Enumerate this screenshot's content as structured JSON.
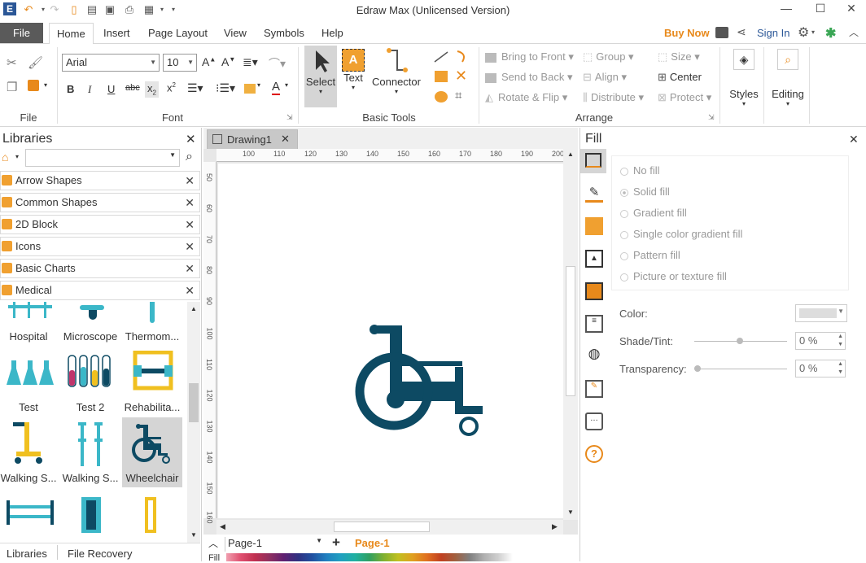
{
  "window": {
    "title": "Edraw Max (Unlicensed Version)"
  },
  "menu": {
    "file": "File",
    "tabs": [
      "Home",
      "Insert",
      "Page Layout",
      "View",
      "Symbols",
      "Help"
    ],
    "buy_now": "Buy Now",
    "sign_in": "Sign In"
  },
  "ribbon": {
    "file_group": "File",
    "font_group": "Font",
    "font_name": "Arial",
    "font_size": "10",
    "basic_tools_group": "Basic Tools",
    "select": "Select",
    "text": "Text",
    "connector": "Connector",
    "arrange_group": "Arrange",
    "bring_to_front": "Bring to Front",
    "send_to_back": "Send to Back",
    "rotate_flip": "Rotate & Flip",
    "group": "Group",
    "align": "Align",
    "distribute": "Distribute",
    "size": "Size",
    "center": "Center",
    "protect": "Protect",
    "styles": "Styles",
    "editing": "Editing"
  },
  "libraries": {
    "title": "Libraries",
    "categories": [
      "Arrow Shapes",
      "Common Shapes",
      "2D Block",
      "Icons",
      "Basic Charts",
      "Medical"
    ],
    "shapes": [
      "Hospital",
      "Microscope",
      "Thermom...",
      "Test",
      "Test 2",
      "Rehabilita...",
      "Walking S...",
      "Walking S...",
      "Wheelchair"
    ],
    "bottom_tabs": [
      "Libraries",
      "File Recovery"
    ]
  },
  "document": {
    "tab": "Drawing1",
    "ruler_h": [
      "100",
      "110",
      "120",
      "130",
      "140",
      "150",
      "160",
      "170",
      "180",
      "190",
      "200"
    ],
    "ruler_v": [
      "50",
      "60",
      "70",
      "80",
      "90",
      "100",
      "110",
      "120",
      "130",
      "140",
      "150",
      "160"
    ],
    "page_select": "Page-1",
    "page_tab": "Page-1",
    "fill_label": "Fill"
  },
  "fill_panel": {
    "title": "Fill",
    "options": [
      "No fill",
      "Solid fill",
      "Gradient fill",
      "Single color gradient fill",
      "Pattern fill",
      "Picture or texture fill"
    ],
    "color_label": "Color:",
    "shade_label": "Shade/Tint:",
    "shade_value": "0 %",
    "transparency_label": "Transparency:",
    "transparency_value": "0 %"
  },
  "colors": {
    "wheelchair": "#0d4a63",
    "accent": "#e8891b"
  }
}
